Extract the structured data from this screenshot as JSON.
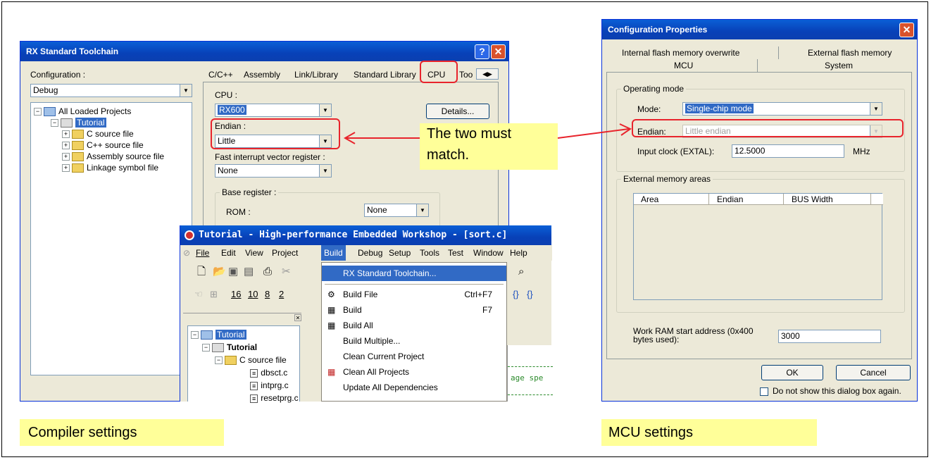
{
  "rx_dialog": {
    "title": "RX Standard Toolchain",
    "configuration_label": "Configuration :",
    "configuration_value": "Debug",
    "tree": {
      "root": "All Loaded Projects",
      "project": "Tutorial",
      "items": [
        "C source file",
        "C++ source file",
        "Assembly source file",
        "Linkage symbol file"
      ]
    },
    "tabs": [
      "C/C++",
      "Assembly",
      "Link/Library",
      "Standard Library",
      "CPU",
      "Too"
    ],
    "cpu_label": "CPU :",
    "cpu_value": "RX600",
    "details_button": "Details...",
    "endian_label": "Endian :",
    "endian_value": "Little",
    "fast_interrupt_label": "Fast interrupt vector register :",
    "fast_interrupt_value": "None",
    "base_register_group": "Base register :",
    "rom_label": "ROM :",
    "rom_value": "None"
  },
  "hew_window": {
    "title": "Tutorial - High-performance Embedded Workshop - [sort.c]",
    "menubar": [
      "File",
      "Edit",
      "View",
      "Project",
      "Build",
      "Debug",
      "Setup",
      "Tools",
      "Test",
      "Window",
      "Help"
    ],
    "toolbar_numbers": [
      "16",
      "10",
      "8",
      "2"
    ],
    "tree": {
      "root": "Tutorial",
      "project": "Tutorial",
      "folder": "C source file",
      "files": [
        "dbsct.c",
        "intprg.c",
        "resetprg.c"
      ]
    },
    "editor_fragment": "age spe",
    "build_menu": [
      {
        "label": "RX Standard Toolchain...",
        "shortcut": ""
      },
      {
        "label": "Build File",
        "shortcut": "Ctrl+F7"
      },
      {
        "label": "Build",
        "shortcut": "F7"
      },
      {
        "label": "Build All",
        "shortcut": ""
      },
      {
        "label": "Build Multiple...",
        "shortcut": ""
      },
      {
        "label": "Clean Current Project",
        "shortcut": ""
      },
      {
        "label": "Clean All Projects",
        "shortcut": ""
      },
      {
        "label": "Update All Dependencies",
        "shortcut": ""
      }
    ]
  },
  "config_dialog": {
    "title": "Configuration Properties",
    "tabs_row1": [
      "Internal flash memory overwrite",
      "External flash memory"
    ],
    "tabs_row2": [
      "MCU",
      "System"
    ],
    "operating_mode_group": "Operating mode",
    "mode_label": "Mode:",
    "mode_value": "Single-chip mode",
    "endian_label": "Endian:",
    "endian_value": "Little endian",
    "input_clock_label": "Input clock (EXTAL):",
    "input_clock_value": "12.5000",
    "input_clock_unit": "MHz",
    "external_memory_group": "External memory areas",
    "columns": [
      "Area",
      "Endian",
      "BUS Width"
    ],
    "work_ram_label": "Work RAM start address (0x400 bytes used):",
    "work_ram_value": "3000",
    "ok_button": "OK",
    "cancel_button": "Cancel",
    "checkbox_label": "Do not show this dialog box again."
  },
  "annotations": {
    "callout": "The two must match.",
    "caption_left": "Compiler settings",
    "caption_right": "MCU settings"
  },
  "colors": {
    "highlight_red": "#e8242c",
    "callout_yellow": "#ffff99",
    "titlebar_blue": "#0a5fd6",
    "selection_blue": "#316ac5"
  }
}
